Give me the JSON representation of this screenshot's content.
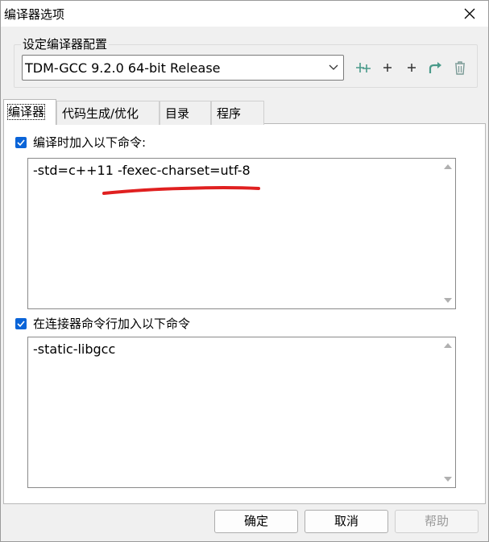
{
  "window": {
    "title": "编译器选项"
  },
  "compiler_config": {
    "group_label": "设定编译器配置",
    "selected": "TDM-GCC 9.2.0 64-bit Release",
    "toolbar_icons": [
      "add-config-icon",
      "add-icon",
      "add-icon",
      "rename-icon",
      "delete-icon"
    ]
  },
  "tabs": [
    {
      "label": "编译器",
      "active": true
    },
    {
      "label": "代码生成/优化",
      "active": false
    },
    {
      "label": "目录",
      "active": false
    },
    {
      "label": "程序",
      "active": false
    }
  ],
  "compiler_commands": {
    "checkbox_label": "编译时加入以下命令:",
    "checked": true,
    "value": "-std=c++11 -fexec-charset=utf-8"
  },
  "linker_commands": {
    "checkbox_label": "在连接器命令行加入以下命令",
    "checked": true,
    "value": "-static-libgcc"
  },
  "buttons": {
    "ok": "确定",
    "cancel": "取消",
    "help": "帮助"
  },
  "colors": {
    "checkbox": "#0a64d8",
    "annotation": "#e02020",
    "toolbar_icon": "#4a9a8a"
  }
}
